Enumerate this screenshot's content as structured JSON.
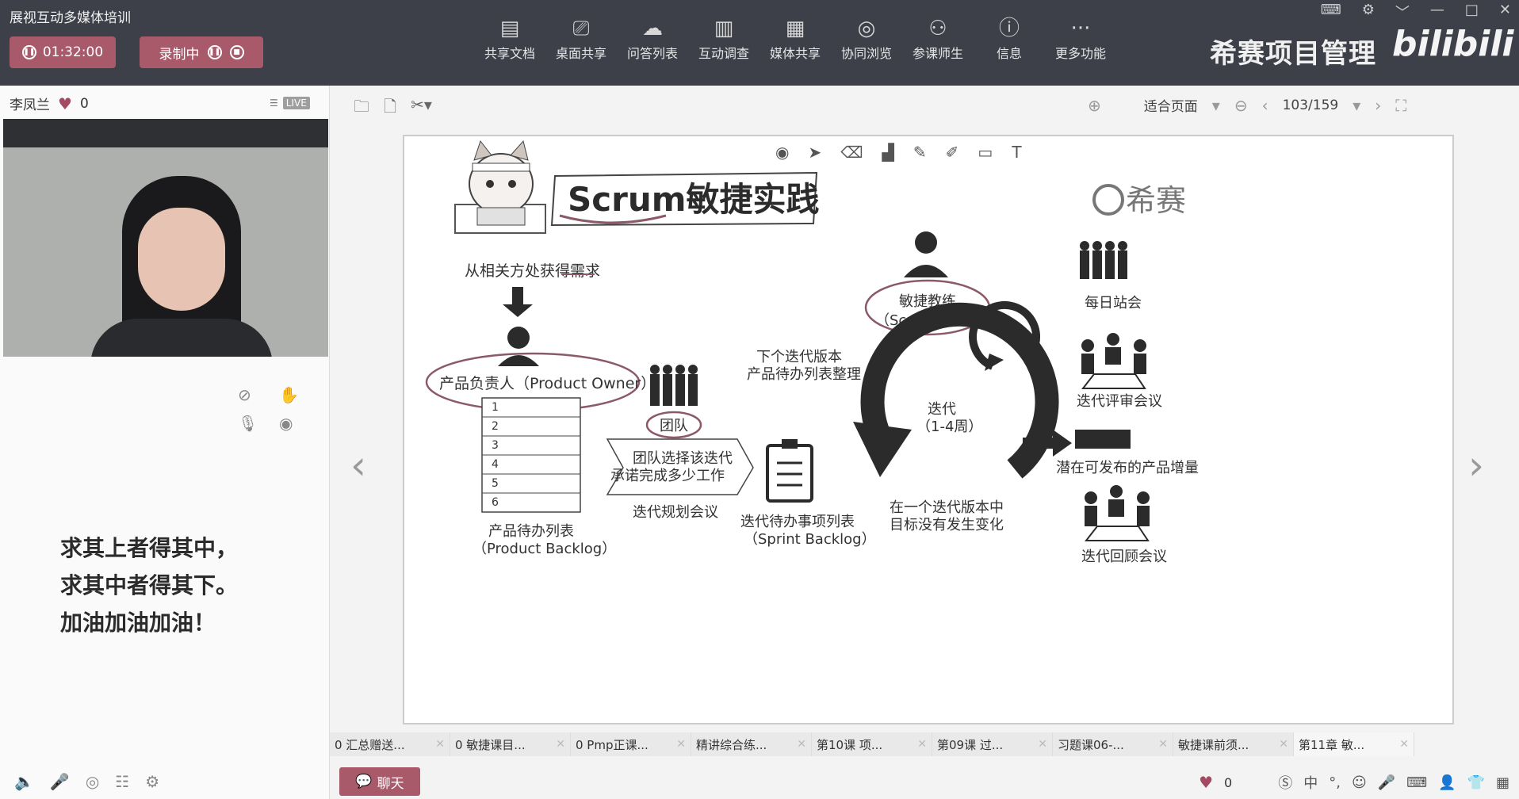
{
  "window": {
    "title": "展视互动多媒体培训"
  },
  "session": {
    "timer": "01:32:00",
    "record_label": "录制中"
  },
  "toolbar": {
    "items": [
      {
        "label": "共享文档",
        "icon": "document-icon"
      },
      {
        "label": "桌面共享",
        "icon": "screen-share-icon"
      },
      {
        "label": "问答列表",
        "icon": "chat-bubbles-icon"
      },
      {
        "label": "互动调查",
        "icon": "bar-chart-icon"
      },
      {
        "label": "媒体共享",
        "icon": "film-icon"
      },
      {
        "label": "协同浏览",
        "icon": "compass-icon"
      },
      {
        "label": "参课师生",
        "icon": "people-icon"
      },
      {
        "label": "信息",
        "icon": "info-icon"
      },
      {
        "label": "更多功能",
        "icon": "more-icon"
      }
    ]
  },
  "brand": {
    "name": "希赛项目管理",
    "logo": "bilibili"
  },
  "user": {
    "name": "李凤兰",
    "likes": "0",
    "live": "LIVE"
  },
  "quote": {
    "line1": "求其上者得其中，",
    "line2": "求其中者得其下。",
    "line3": "加油加油加油！"
  },
  "viewer": {
    "fit": "适合页面",
    "page": "103/159"
  },
  "slide": {
    "title": "Scrum敏捷实践",
    "logo": "希赛",
    "get_requirements": "从相关方处获得需求",
    "product_owner": "产品负责人（Product Owner）",
    "backlog_rows": [
      "1",
      "2",
      "3",
      "4",
      "5",
      "6"
    ],
    "product_backlog_cn": "产品待办列表",
    "product_backlog_en": "（Product Backlog）",
    "team": "团队",
    "team_select_1": "团队选择该迭代",
    "team_select_2": "承诺完成多少工作",
    "planning": "迭代规划会议",
    "sprint_backlog_cn": "迭代待办事项列表",
    "sprint_backlog_en": "（Sprint Backlog）",
    "next_version_1": "下个迭代版本",
    "next_version_2": "产品待办列表整理",
    "scrum_master_cn": "敏捷教练",
    "scrum_master_en": "（Scrum Master）",
    "iteration": "迭代",
    "iteration_weeks": "（1-4周）",
    "no_change_1": "在一个迭代版本中",
    "no_change_2": "目标没有发生变化",
    "daily_standup": "每日站会",
    "review": "迭代评审会议",
    "increment": "潜在可发布的产品增量",
    "retro": "迭代回顾会议"
  },
  "tabs": [
    "0 汇总赠送...",
    "0 敏捷课目...",
    "0 Pmp正课...",
    "精讲综合练...",
    "第10课 项...",
    "第09课 过...",
    "习题课06-...",
    "敏捷课前须...",
    "第11章 敏..."
  ],
  "bottom": {
    "chat": "聊天",
    "likes": "0"
  }
}
